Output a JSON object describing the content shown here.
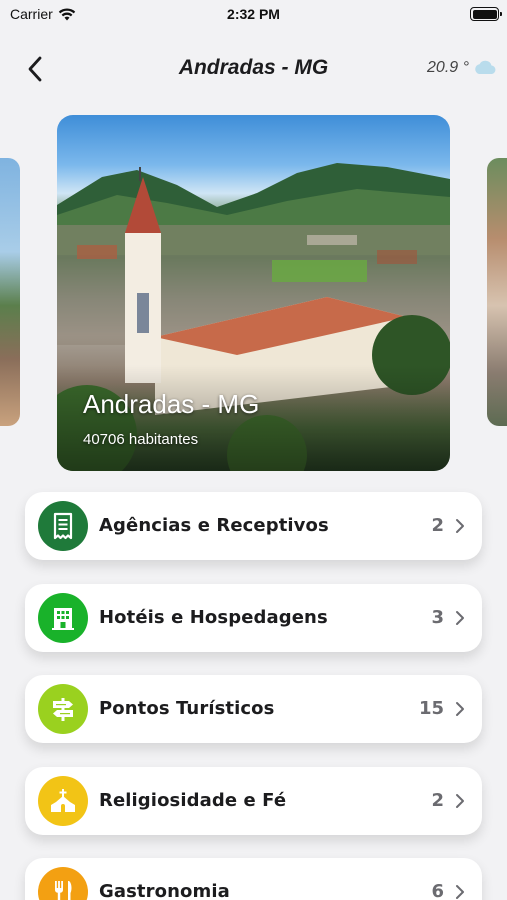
{
  "status_bar": {
    "carrier": "Carrier",
    "time": "2:32 PM",
    "battery_level": 1.0
  },
  "nav": {
    "title": "Andradas - MG",
    "temperature": "20.9 °",
    "back_icon": "chevron-left-icon",
    "weather_icon": "cloud-icon"
  },
  "city_card": {
    "title": "Andradas - MG",
    "subtitle": "40706 habitantes"
  },
  "categories": [
    {
      "label": "Agências e Receptivos",
      "count": "2",
      "icon": "receipt-icon",
      "color": "#1f7a3a"
    },
    {
      "label": "Hotéis e Hospedagens",
      "count": "3",
      "icon": "building-icon",
      "color": "#19b22a"
    },
    {
      "label": "Pontos Turísticos",
      "count": "15",
      "icon": "signpost-icon",
      "color": "#9ad11f"
    },
    {
      "label": "Religiosidade e Fé",
      "count": "2",
      "icon": "church-icon",
      "color": "#f2c416"
    },
    {
      "label": "Gastronomia",
      "count": "6",
      "icon": "fork-knife-icon",
      "color": "#f3a012"
    }
  ]
}
